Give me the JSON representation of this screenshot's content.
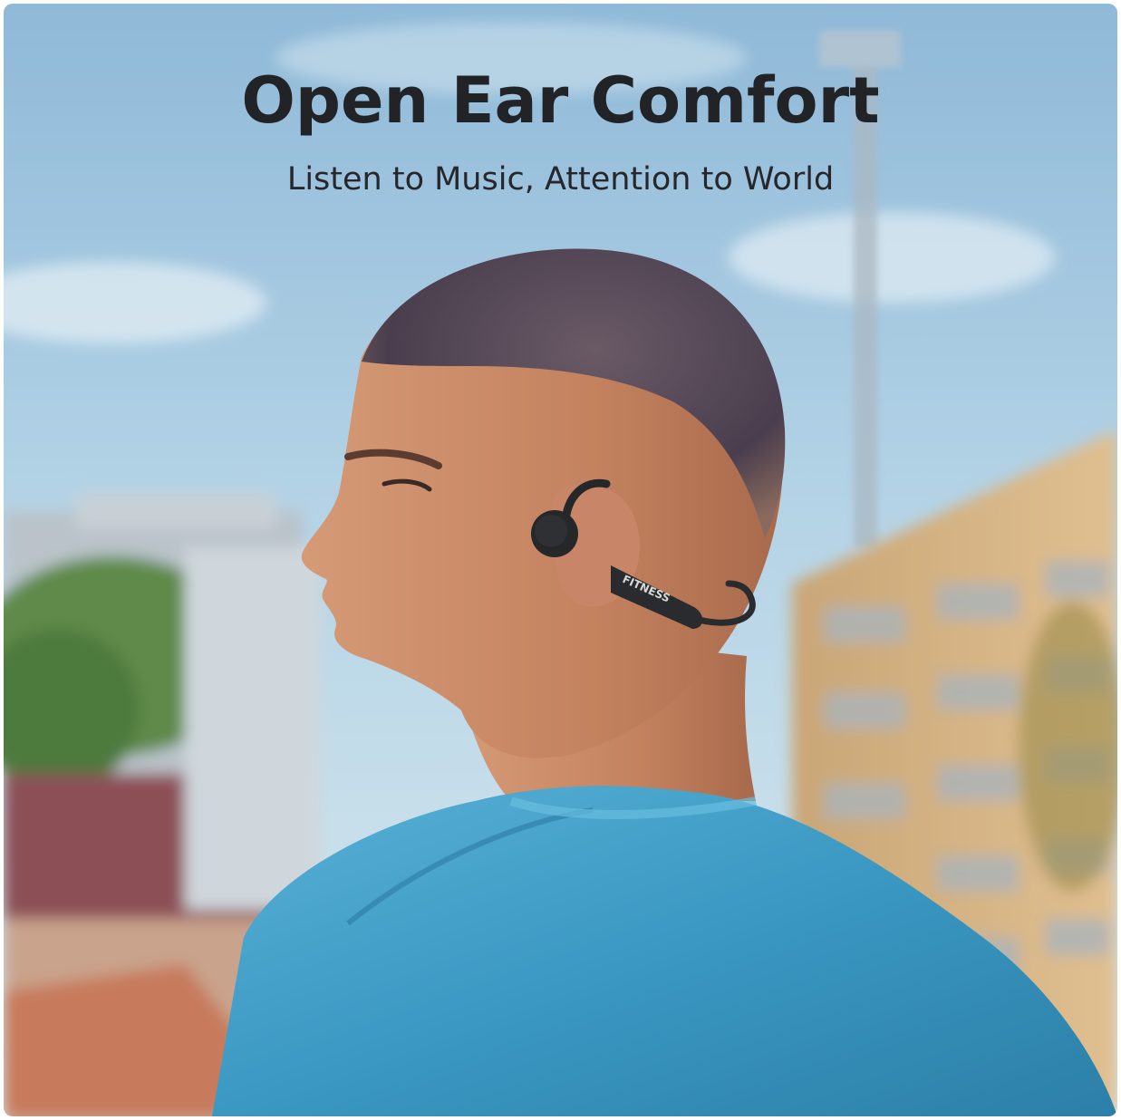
{
  "banner": {
    "headline": "Open Ear Comfort",
    "subheadline": "Listen to Music, Attention to World"
  },
  "product": {
    "band_text": "FITNESS"
  },
  "colors": {
    "headline": "#222326",
    "subheadline": "#26272b",
    "sky_top": "#9fc4df",
    "sky_bottom": "#d3e6ef",
    "shirt": "#3f9fc7",
    "skin": "#c98a67",
    "hair": "#4b3f4c",
    "earphone": "#262729",
    "building": "#d6b283",
    "foliage": "#5e8a4a"
  }
}
